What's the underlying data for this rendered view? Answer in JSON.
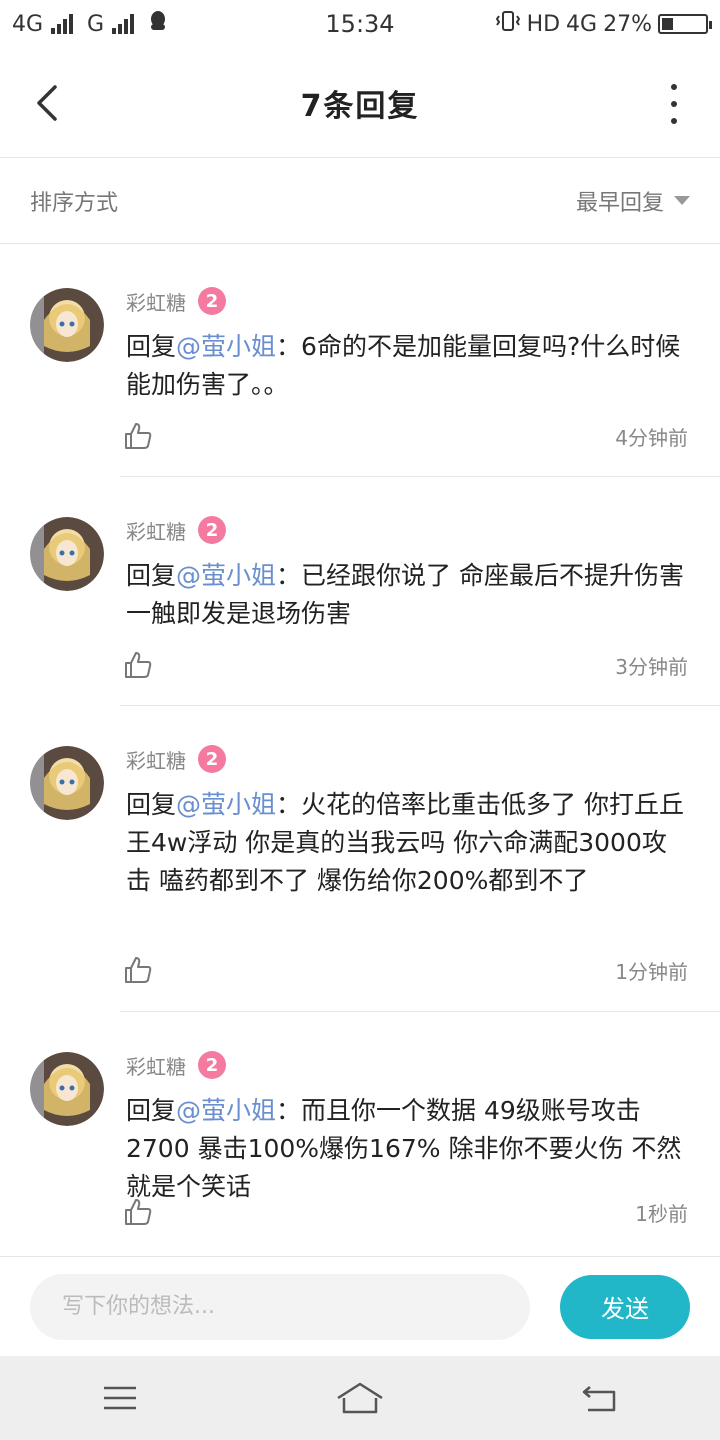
{
  "status_bar": {
    "network1": "4G",
    "network2": "G",
    "time": "15:34",
    "hd": "HD",
    "network3": "4G",
    "battery_text": "27%",
    "battery_level": 0.27
  },
  "header": {
    "title": "7条回复"
  },
  "sort": {
    "label": "排序方式",
    "selected": "最早回复"
  },
  "replies": [
    {
      "username": "彩虹糖",
      "level": "2",
      "prefix": "回复",
      "mention": "@萤小姐",
      "separator": "：",
      "text": "6命的不是加能量回复吗?什么时候能加伤害了。。",
      "time": "4分钟前"
    },
    {
      "username": "彩虹糖",
      "level": "2",
      "prefix": "回复",
      "mention": "@萤小姐",
      "separator": "：",
      "text": "已经跟你说了 命座最后不提升伤害 一触即发是退场伤害",
      "time": "3分钟前"
    },
    {
      "username": "彩虹糖",
      "level": "2",
      "prefix": "回复",
      "mention": "@萤小姐",
      "separator": "：",
      "text": "火花的倍率比重击低多了 你打丘丘王4w浮动 你是真的当我云吗 你六命满配3000攻击 嗑药都到不了 爆伤给你200%都到不了",
      "time": "1分钟前"
    },
    {
      "username": "彩虹糖",
      "level": "2",
      "prefix": "回复",
      "mention": "@萤小姐",
      "separator": "：",
      "text": "而且你一个数据 49级账号攻击2700 暴击100%爆伤167% 除非你不要火伤 不然就是个笑话",
      "time": "1秒前"
    }
  ],
  "input": {
    "placeholder": "写下你的想法...",
    "send_label": "发送"
  },
  "colors": {
    "accent": "#21b7c8",
    "level_badge": "#f47aa0",
    "mention": "#6a8fd0"
  },
  "icons": {
    "back": "chevron-left-icon",
    "more": "more-vertical-icon",
    "like": "thumbs-up-icon",
    "nav_menu": "menu-icon",
    "nav_home": "home-icon",
    "nav_back": "return-icon"
  }
}
